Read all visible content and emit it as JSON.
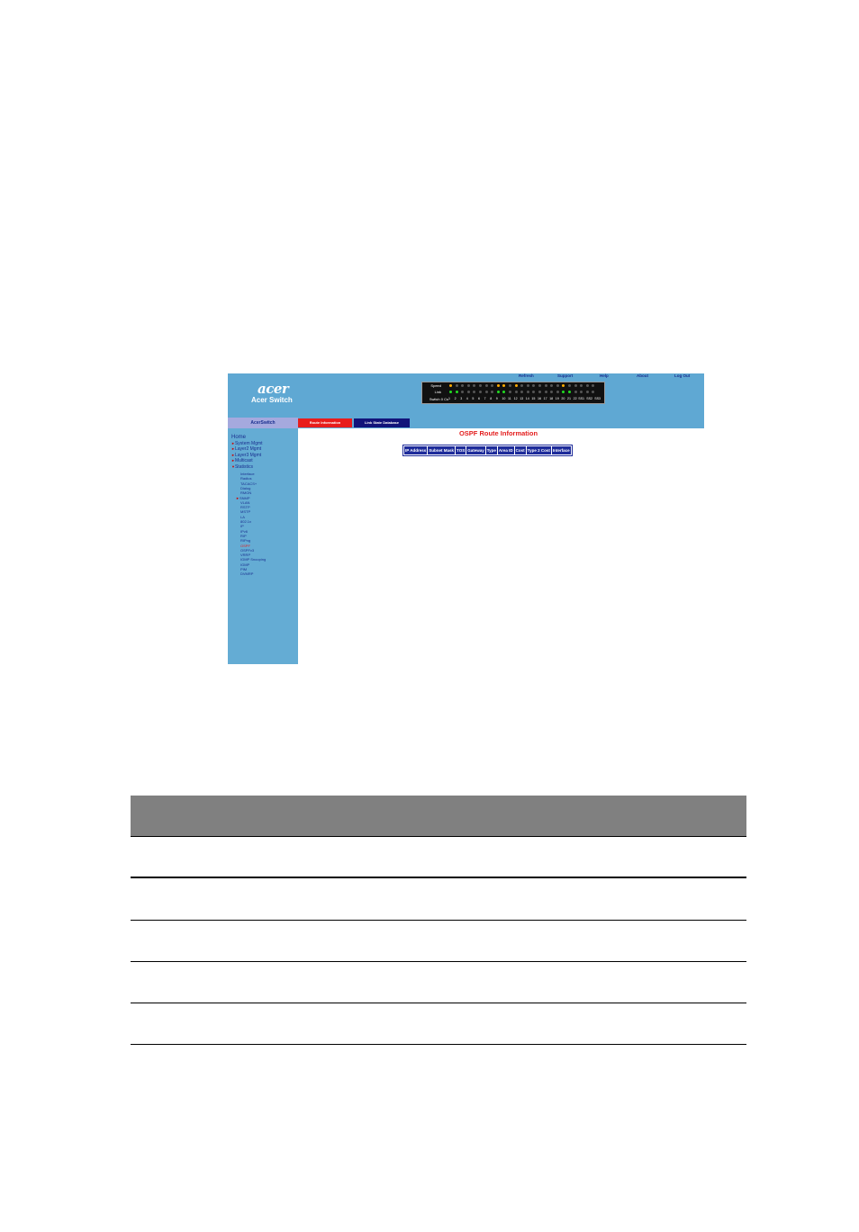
{
  "app": {
    "logo": "acer",
    "product_name": "Acer Switch"
  },
  "topnav": [
    "Refresh",
    "Support",
    "Help",
    "About",
    "Log Out"
  ],
  "panel": {
    "labels": [
      "Speed",
      "Link",
      "Switch 0 Cs"
    ],
    "ports": [
      "1",
      "2",
      "3",
      "4",
      "5",
      "6",
      "7",
      "8",
      "9",
      "10",
      "11",
      "12",
      "13",
      "14",
      "15",
      "16",
      "17",
      "18",
      "19",
      "20",
      "21",
      "22",
      "SS1",
      "SS2",
      "SS3"
    ],
    "colors": {
      "amber": "#ffaa00",
      "green": "#22dd22",
      "off": "#555555"
    }
  },
  "sidebar": {
    "header": "AcerSwitch",
    "home": "Home",
    "sections": [
      "System Mgmt",
      "Layer2 Mgmt",
      "Layer3 Mgmt",
      "Multicast",
      "Statistics"
    ],
    "sub_items": [
      "Interface",
      "Radius",
      "TACACS+",
      "Dialog",
      "RMON",
      "SNMP",
      "VLAN",
      "RSTP",
      "MSTP",
      "LA",
      "802.1x",
      "IP",
      "IPv6",
      "RIP",
      "RIPng",
      "OSPF",
      "OSPFv3",
      "VRRP",
      "IGMP Snooping",
      "IGMP",
      "PIM",
      "DVMRP"
    ]
  },
  "tabs": [
    {
      "label": "Route Information",
      "color": "#e81c1c"
    },
    {
      "label": "Link State Database",
      "color": "#12147a"
    }
  ],
  "content": {
    "title": "OSPF Route Information",
    "columns": [
      "IP Address",
      "Subnet Mask",
      "TOS",
      "Gateway",
      "Type",
      "Area ID",
      "Cost",
      "Type 2 Cost",
      "Interface"
    ]
  }
}
